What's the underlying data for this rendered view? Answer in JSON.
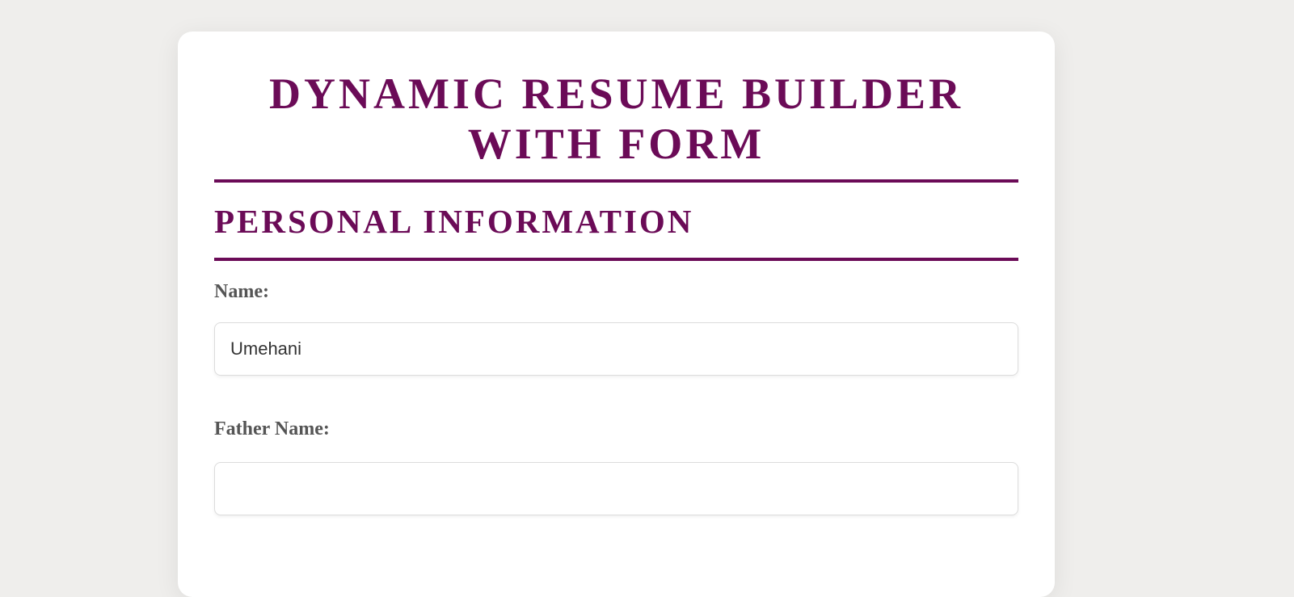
{
  "page": {
    "title": "DYNAMIC RESUME BUILDER WITH FORM"
  },
  "personal_section": {
    "heading": "PERSONAL INFORMATION",
    "name_label": "Name:",
    "name_value": "Umehani",
    "father_name_label": "Father Name:",
    "father_name_value": ""
  },
  "colors": {
    "accent": "#6b0b57",
    "background": "#efeeec",
    "card": "#ffffff",
    "label": "#555555"
  }
}
